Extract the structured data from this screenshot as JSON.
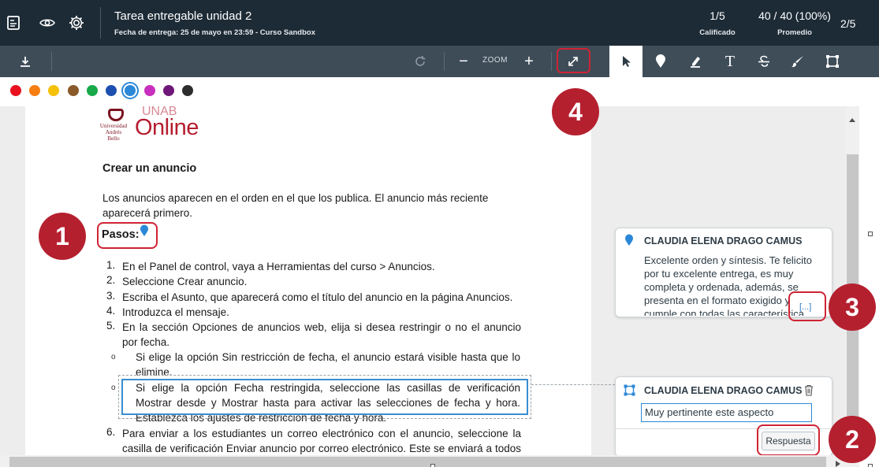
{
  "header": {
    "title": "Tarea entregable unidad 2",
    "due": "Fecha de entrega: 25 de mayo en 23:59 - Curso Sandbox",
    "graded_value": "1/5",
    "graded_label": "Calificado",
    "average_value": "40 / 40 (100%)",
    "average_label": "Promedio",
    "student_index": "2/5"
  },
  "toolbar": {
    "zoom_label": "ZOOM",
    "zoom_minus": "−",
    "zoom_plus": "+",
    "text_tool": "T"
  },
  "palette": {
    "colors": [
      "#e8121e",
      "#f77d10",
      "#f5c105",
      "#8a5a2a",
      "#17a94a",
      "#1c4fb0",
      "#2b88d8",
      "#c92fbf",
      "#6f1778",
      "#2d2d2d"
    ],
    "selected_index": 6
  },
  "document": {
    "logo_small_text": "Universidad Andrés Bello",
    "logo_unab": "UNAB",
    "logo_online": "Online",
    "heading": "Crear un anuncio",
    "intro": "Los anuncios aparecen en el orden en el que los publica. El anuncio más reciente aparecerá primero.",
    "steps_label": "Pasos:",
    "steps": [
      {
        "num": "1.",
        "text": "En el Panel de control, vaya a Herramientas del curso > Anuncios."
      },
      {
        "num": "2.",
        "text": "Seleccione Crear anuncio."
      },
      {
        "num": "3.",
        "text": "Escriba el Asunto, que aparecerá como el título del anuncio en la página Anuncios."
      },
      {
        "num": "4.",
        "text": "Introduzca el mensaje."
      },
      {
        "num": "5.",
        "text": "En la sección Opciones de anuncios web, elija si desea restringir o no el anuncio por fecha."
      }
    ],
    "sub_steps": [
      "Si elige la opción Sin restricción de fecha, el anuncio estará visible hasta que lo elimine.",
      "Si elige la opción Fecha restringida, seleccione las casillas de verificación Mostrar desde y Mostrar hasta para activar las selecciones de fecha y hora. Establezca los ajustes de restricción de fecha y hora."
    ],
    "step6_num": "6.",
    "step6_text": "Para enviar a los estudiantes un correo electrónico con el anuncio, seleccione la casilla de verificación Enviar anuncio por correo electrónico. Este se enviará a todos los"
  },
  "comments": [
    {
      "author": "CLAUDIA ELENA DRAGO CAMUS",
      "text": "Excelente orden y síntesis. Te felicito por tu excelente entrega, es muy completa y ordenada, además, se presenta en el formato exigido y cumple con todas las característica",
      "more": "[...]"
    },
    {
      "author": "CLAUDIA ELENA DRAGO CAMUS",
      "text": "Muy pertinente este aspecto",
      "reply_button": "Respuesta"
    }
  ],
  "callouts": [
    "1",
    "2",
    "3",
    "4"
  ],
  "icons": {
    "header": [
      "submission-icon",
      "eye-icon",
      "gear-icon"
    ],
    "toolbar": [
      "download-icon",
      "rotate-icon",
      "expand-icon",
      "pointer-icon",
      "pin-icon",
      "highlighter-icon",
      "text-icon",
      "strikethrough-icon",
      "brush-icon",
      "area-icon"
    ]
  }
}
